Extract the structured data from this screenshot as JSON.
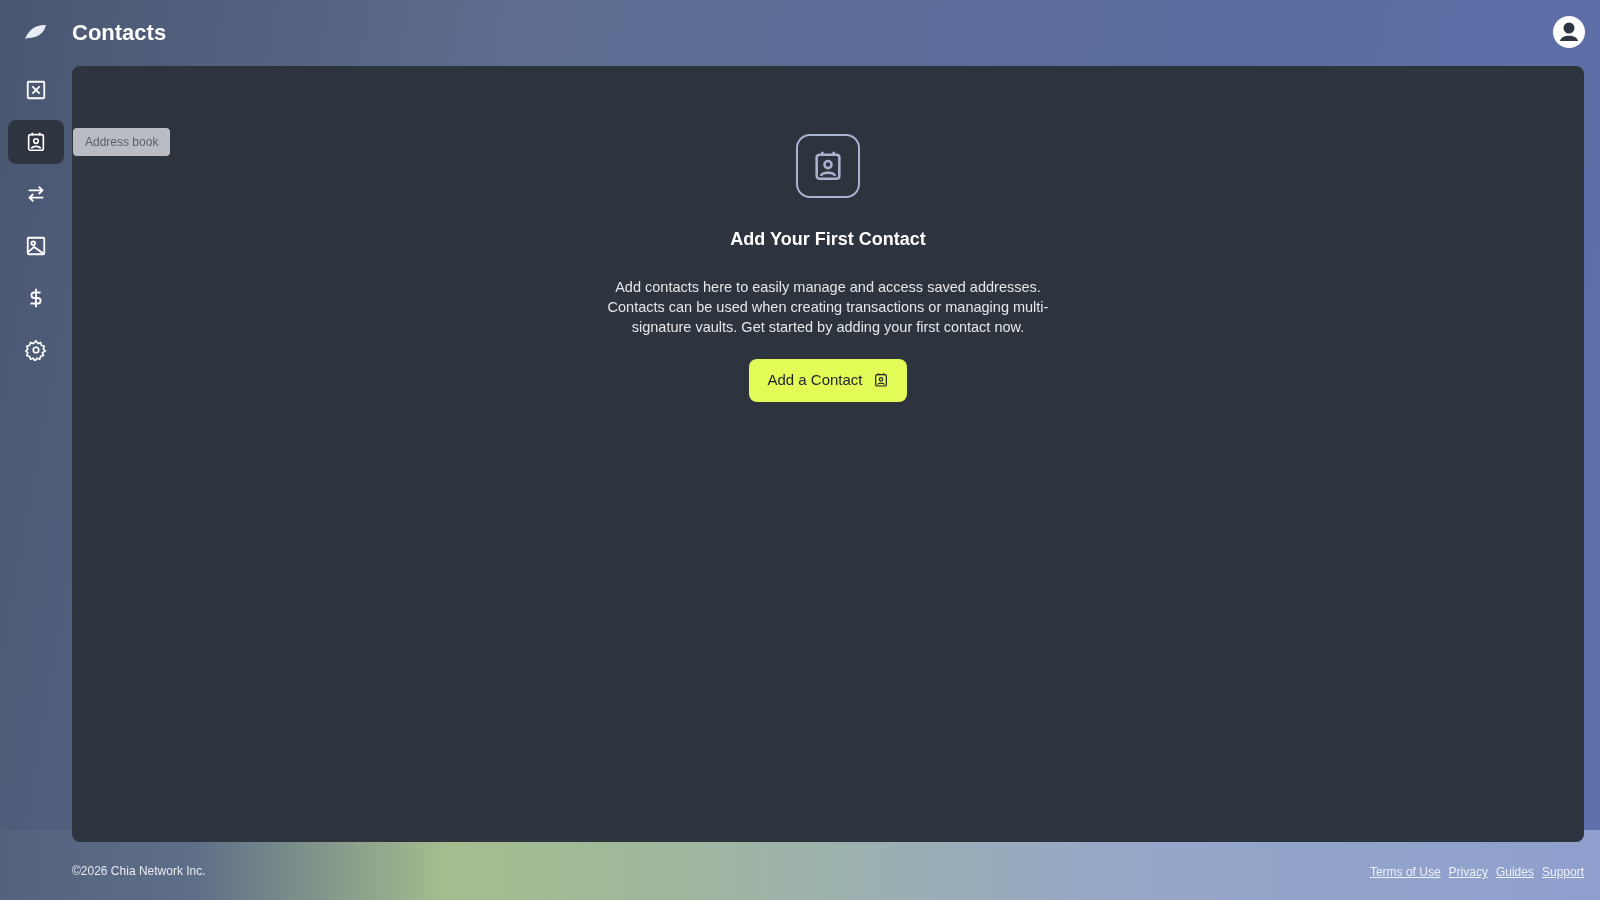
{
  "header": {
    "title": "Contacts"
  },
  "sidebar": {
    "items": [
      {
        "kind": "vault",
        "selected": false
      },
      {
        "kind": "contacts",
        "selected": true,
        "tooltip": "Address book"
      },
      {
        "kind": "transfer",
        "selected": false
      },
      {
        "kind": "image",
        "selected": false
      },
      {
        "kind": "dollar",
        "selected": false
      },
      {
        "kind": "settings",
        "selected": false
      }
    ]
  },
  "empty_state": {
    "title": "Add Your First Contact",
    "description": "Add contacts here to easily manage and access saved addresses. Contacts can be used when creating transactions or managing multi-signature vaults. Get started by adding your first contact now.",
    "button": "Add a Contact"
  },
  "footer": {
    "copyright": "©2026 Chia Network Inc.",
    "links": [
      "Terms of Use",
      "Privacy",
      "Guides",
      "Support"
    ]
  }
}
